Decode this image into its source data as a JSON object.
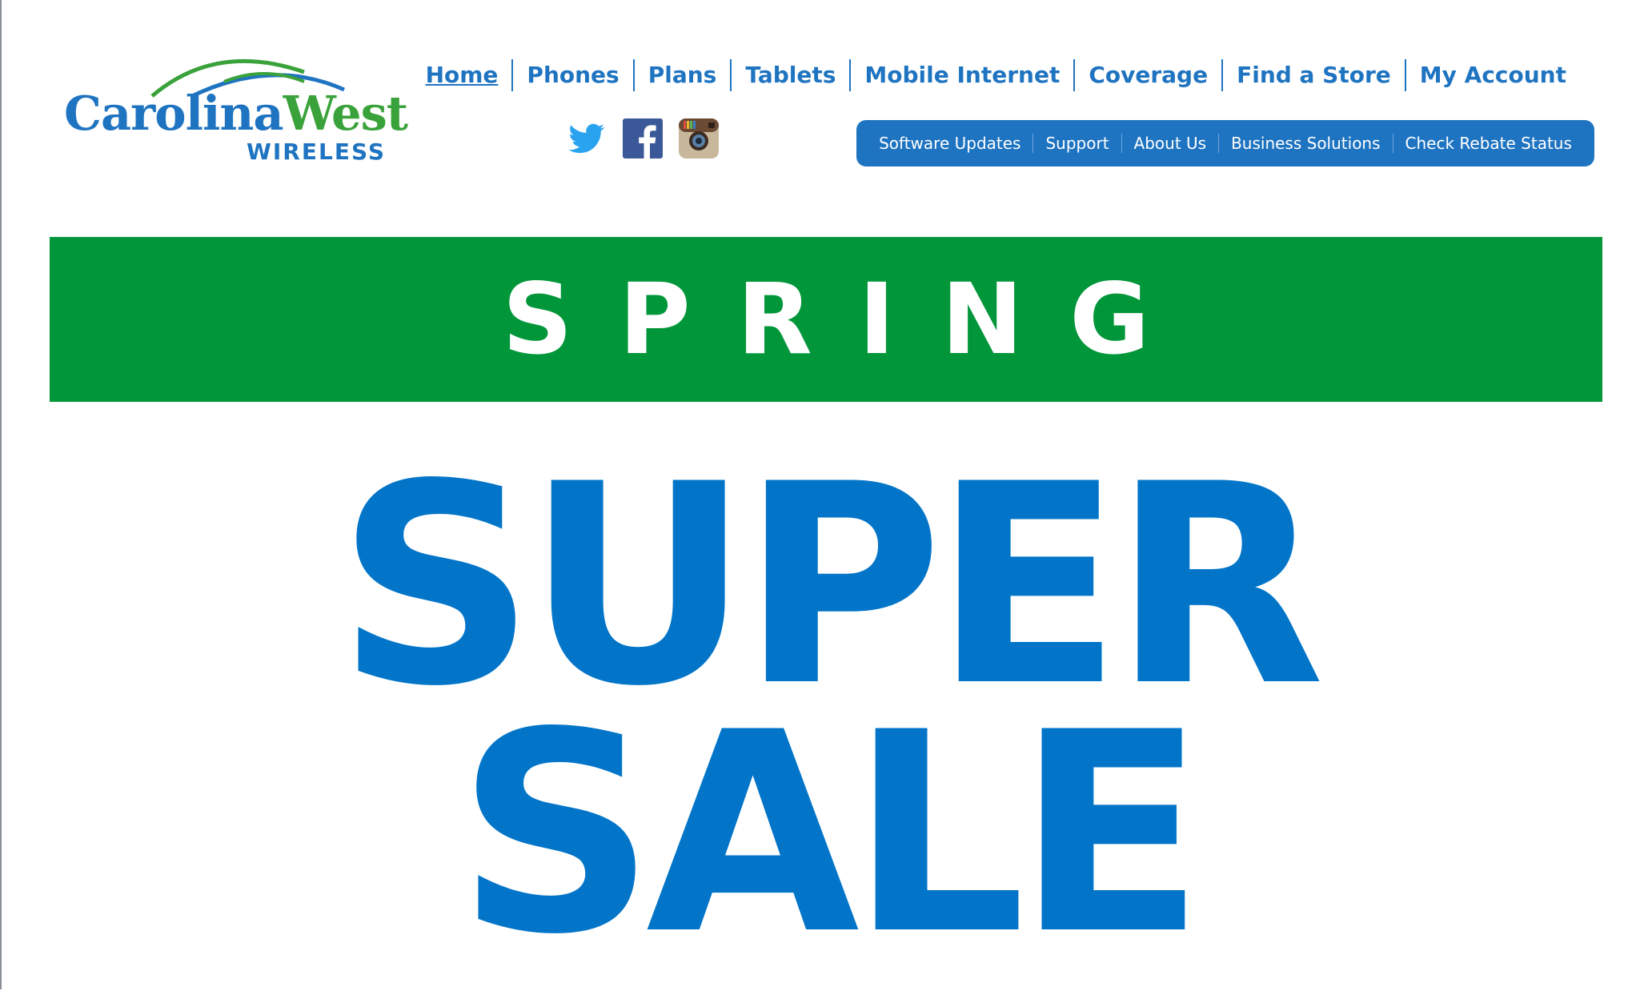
{
  "logo": {
    "word_primary": "Carolina",
    "word_secondary": "West",
    "subtitle": "WIRELESS",
    "colors": {
      "blue": "#1f74c1",
      "green": "#3aa23a"
    }
  },
  "main_nav": {
    "items": [
      "Home",
      "Phones",
      "Plans",
      "Tablets",
      "Mobile Internet",
      "Coverage",
      "Find a Store",
      "My Account"
    ]
  },
  "social": {
    "icons": [
      "twitter-icon",
      "facebook-icon",
      "instagram-icon"
    ]
  },
  "sub_nav": {
    "items": [
      "Software Updates",
      "Support",
      "About Us",
      "Business Solutions",
      "Check Rebate Status"
    ]
  },
  "banner": {
    "season": "SPRING",
    "headline_line1": "SUPER",
    "headline_line2": "SALE",
    "colors": {
      "banner_green": "#02963a",
      "headline_blue": "#0275c9"
    }
  }
}
